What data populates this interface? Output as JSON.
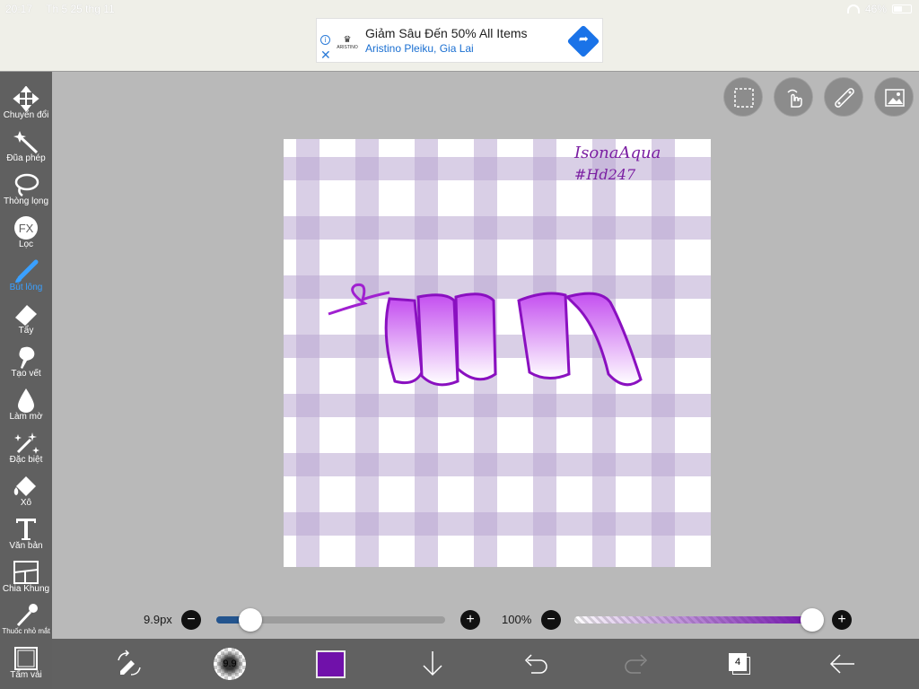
{
  "status_bar": {
    "time": "20:17",
    "date": "Th 5 25 thg 11",
    "battery": "46%"
  },
  "ad": {
    "brand": "ARISTINO",
    "title": "Giảm Sâu Đến 50% All Items",
    "subtitle": "Aristino Pleiku, Gia Lai",
    "info_icon": "info-icon",
    "close_icon": "close-icon"
  },
  "toolbar": {
    "items": [
      {
        "label": "Chuyển đổi",
        "icon": "move-arrows-icon"
      },
      {
        "label": "Đũa phép",
        "icon": "magic-wand-icon"
      },
      {
        "label": "Thòng lọng",
        "icon": "lasso-icon"
      },
      {
        "label": "Lọc",
        "icon": "fx-filter-icon"
      },
      {
        "label": "Bút lông",
        "icon": "brush-icon",
        "active": true
      },
      {
        "label": "Tẩy",
        "icon": "eraser-icon"
      },
      {
        "label": "Tạo vết",
        "icon": "smudge-icon"
      },
      {
        "label": "Làm mờ",
        "icon": "blur-drop-icon"
      },
      {
        "label": "Đặc biệt",
        "icon": "special-sparkle-icon"
      },
      {
        "label": "Xô",
        "icon": "bucket-icon"
      },
      {
        "label": "Văn bản",
        "icon": "text-icon"
      },
      {
        "label": "Chia Khung",
        "icon": "frame-divider-icon"
      },
      {
        "label": "Thuốc nhỏ mắt",
        "icon": "eyedropper-icon"
      },
      {
        "label": "Tấm vải",
        "icon": "canvas-icon"
      }
    ],
    "active_color": "#3aa0ff"
  },
  "canvas": {
    "signature_line1": "IsonaAqua",
    "signature_line2": "#Hd247",
    "gingham_color": "#b9a8d2",
    "ribbon_color_top": "#c44ff0",
    "ribbon_color_bottom": "#ffffff"
  },
  "quick_actions": [
    "selection-icon",
    "gesture-hand-icon",
    "ruler-icon",
    "image-icon"
  ],
  "brush_size": {
    "label": "9.9px",
    "value_fraction": 0.15,
    "fill_color": "#23548e"
  },
  "opacity": {
    "label": "100%",
    "value": 100,
    "color": "#7011aa"
  },
  "bottom_bar": {
    "brush_preview_label": "9.9",
    "current_color": "#7011aa",
    "layer_count": "4"
  }
}
